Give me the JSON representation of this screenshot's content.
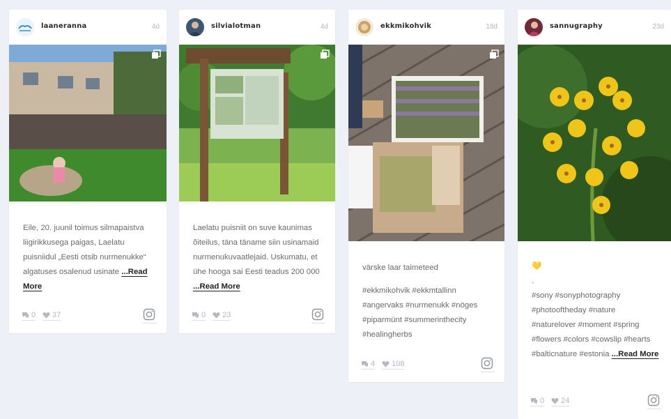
{
  "posts": [
    {
      "username": "laaneranna",
      "age": "4d",
      "caption": "Eile, 20. juunil toimus silmapaistva liigirikkusega paigas, Laelatu puisniidul „Eesti otsib nurmenukke“ algatuses osalenud usinate",
      "read_more": "...Read More",
      "hashtags": "",
      "comments": "0",
      "likes": "37",
      "icon": "instagram-icon"
    },
    {
      "username": "silvialotman",
      "age": "4d",
      "caption": "Laelatu puisniit on suve kaunimas õiteilus, täna täname siin usinamaid nurmenukuvaatlejaid. Uskumatu, et ühe hooga sai Eesti teadus 200 000",
      "read_more": "...Read More",
      "hashtags": "",
      "comments": "0",
      "likes": "23",
      "icon": "instagram-icon"
    },
    {
      "username": "ekkmikohvik",
      "age": "18d",
      "caption": "värske laar taimeteed",
      "read_more": "",
      "hashtags": "#ekkmikohvik #ekkmtallinn #angervaks #nurmenukk #nöges #piparmünt #summerinthecity #healingherbs",
      "comments": "4",
      "likes": "108",
      "icon": "instagram-icon"
    },
    {
      "username": "sannugraphy",
      "age": "23d",
      "caption": "💛",
      "caption2": ".",
      "hashtags": "#sony #sonyphotography #photooftheday #nature #naturelover #moment #spring #flowers #colors #cowslip #hearts #balticnature #estonia",
      "read_more": "...Read More",
      "comments": "0",
      "likes": "24",
      "icon": "instagram-icon"
    }
  ]
}
